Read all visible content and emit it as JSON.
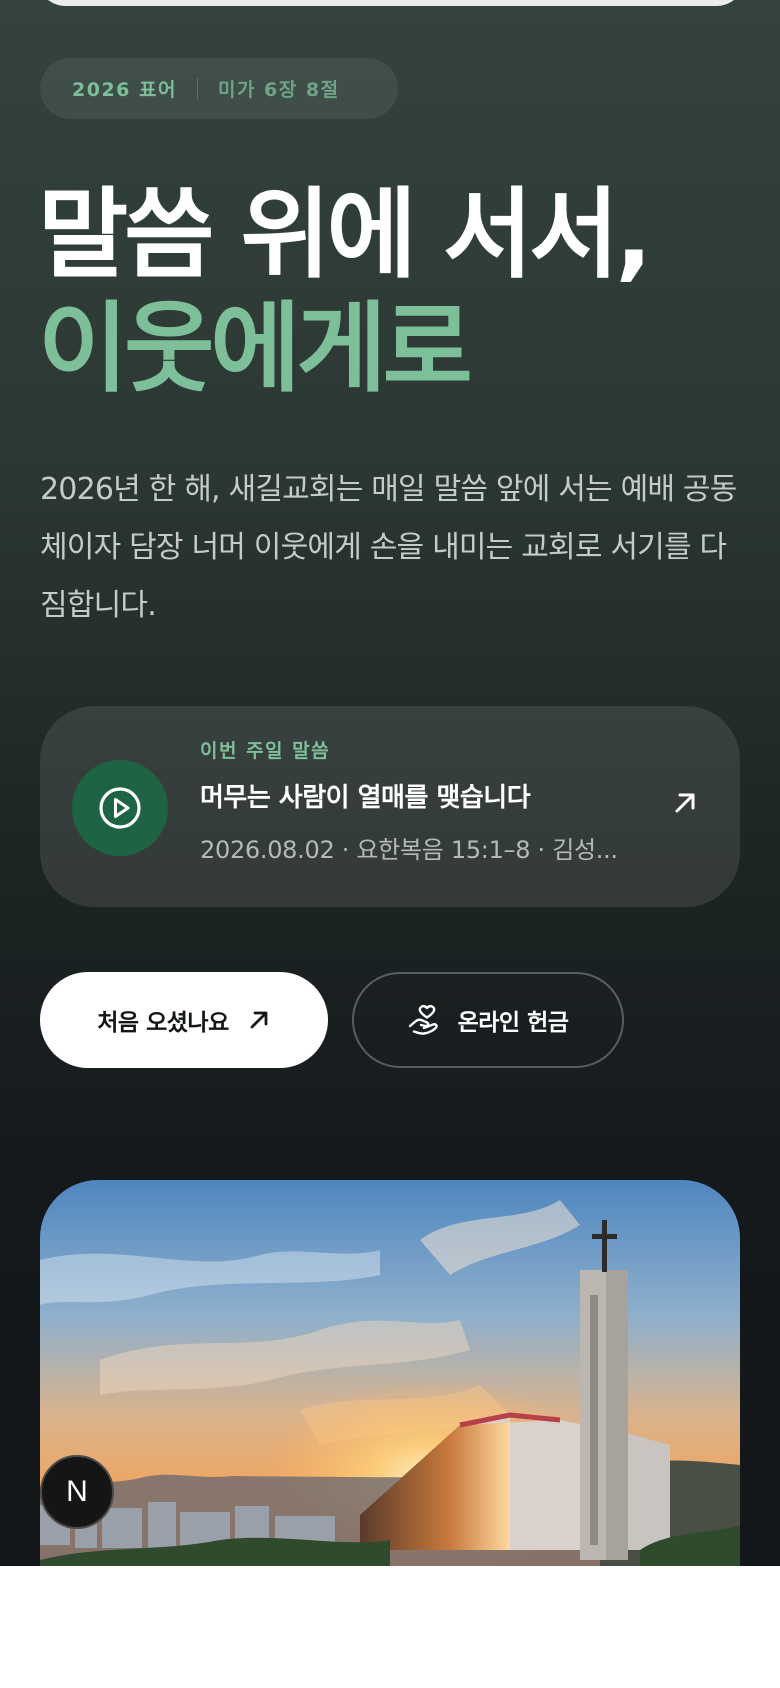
{
  "hero": {
    "tag_year": "2026 표어",
    "tag_verse": "미가 6장 8절",
    "headline_line1": "말씀 위에 서서,",
    "headline_line2": "이웃에게로",
    "intro": "2026년 한 해, 새길교회는 매일 말씀 앞에 서는 예배 공동체이자 담장 너머 이웃에게 손을 내미는 교회로 서기를 다짐합니다."
  },
  "sermon": {
    "label": "이번 주일 말씀",
    "title": "머무는 사람이 열매를 맺습니다",
    "meta": "2026.08.02 · 요한복음 15:1–8 · 김성..."
  },
  "buttons": {
    "first_visit": "처음 오셨나요",
    "donate": "온라인 헌금"
  },
  "avatar": {
    "letter": "N"
  },
  "icons": {
    "play": "play-circle-icon",
    "sermon_arrow": "arrow-up-right-icon",
    "first_visit_arrow": "arrow-up-right-icon",
    "donate": "hand-heart-icon"
  },
  "colors": {
    "accent": "#7dbf98",
    "play_bg": "#1f6345",
    "hero_top": "#34433e",
    "hero_bottom": "#141719"
  }
}
